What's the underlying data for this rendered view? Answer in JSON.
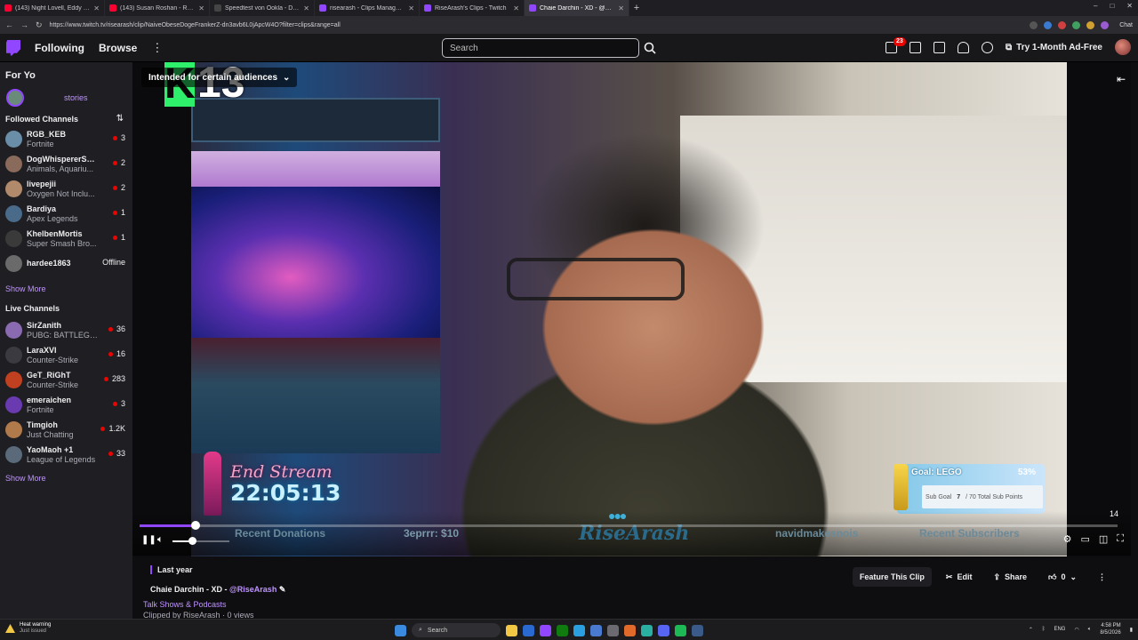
{
  "browser": {
    "tabs": [
      {
        "title": "(143) Night Lovell, Eddy Baker, BO",
        "favicon_color": "#ff0033",
        "active": false
      },
      {
        "title": "(143) Susan Roshan - Roohe Sheyd",
        "favicon_color": "#ff0033",
        "active": false
      },
      {
        "title": "Speedtest von Ookla - Der umfass",
        "favicon_color": "#444444",
        "active": false
      },
      {
        "title": "risearash - Clips Manager - Twitch",
        "favicon_color": "#9147ff",
        "active": false
      },
      {
        "title": "RiseArash's Clips - Twitch",
        "favicon_color": "#9147ff",
        "active": false
      },
      {
        "title": "Chaie Darchin - XD - @RiseArash",
        "favicon_color": "#9147ff",
        "active": true
      }
    ],
    "url": "https://www.twitch.tv/risearash/clip/NaiveObeseDogeFrankerZ-dn3avb6L0jApcW4O?filter=clips&range=all",
    "chat_label": "Chat"
  },
  "topnav": {
    "following": "Following",
    "browse": "Browse",
    "search_placeholder": "Search",
    "notifications_count": "23",
    "ad_free": "Try 1-Month Ad-Free"
  },
  "sidebar": {
    "for_you_label": "For Yo",
    "stories_label": "stories",
    "followed_header": "Followed Channels",
    "followed": [
      {
        "name": "RGB_KEB",
        "game": "Fortnite",
        "viewers": "3",
        "live": true,
        "avatar_color": "#6a8ea8"
      },
      {
        "name": "DogWhispererSh...",
        "game": "Animals, Aquariu...",
        "viewers": "2",
        "live": true,
        "avatar_color": "#8a6a5a"
      },
      {
        "name": "livepejii",
        "game": "Oxygen Not Inclu...",
        "viewers": "2",
        "live": true,
        "avatar_color": "#b08a6a"
      },
      {
        "name": "Bardiya",
        "game": "Apex Legends",
        "viewers": "1",
        "live": true,
        "avatar_color": "#4a6a8a"
      },
      {
        "name": "KhelbenMortis",
        "game": "Super Smash Bro...",
        "viewers": "1",
        "live": true,
        "avatar_color": "#3a3a3a"
      },
      {
        "name": "hardee1863",
        "game": "",
        "viewers": "Offline",
        "live": false,
        "avatar_color": "#6a6a6a"
      }
    ],
    "show_more": "Show More",
    "live_header": "Live Channels",
    "live": [
      {
        "name": "SirZanith",
        "game": "PUBG: BATTLEGR...",
        "viewers": "36",
        "avatar_color": "#8a6ab0"
      },
      {
        "name": "LaraXVI",
        "game": "Counter-Strike",
        "viewers": "16",
        "avatar_color": "#3a3a40"
      },
      {
        "name": "GeT_RiGhT",
        "game": "Counter-Strike",
        "viewers": "283",
        "avatar_color": "#c04020"
      },
      {
        "name": "emeraichen",
        "game": "Fortnite",
        "viewers": "3",
        "avatar_color": "#6a3ab0"
      },
      {
        "name": "Timgioh",
        "game": "Just Chatting",
        "viewers": "1.2K",
        "avatar_color": "#b07a4a"
      },
      {
        "name": "YaoMaoh +1",
        "game": "League of Legends",
        "viewers": "33",
        "avatar_color": "#5a6a7a"
      }
    ],
    "show_more_2": "Show More"
  },
  "video": {
    "k_badge": "K",
    "rating_number": "13",
    "audience_label": "Intended for certain audiences",
    "end_stream_label": "End Stream",
    "end_stream_time": "22:05:13",
    "goal_label": "Goal:  LEGO",
    "goal_percent": "53%",
    "goal_sub_label": "Sub Goal",
    "goal_sub_count": "7",
    "goal_sub_total": "/ 70 Total Sub Points",
    "overlay_recent_donations": "Recent Donations",
    "overlay_donation": "3eprrr: $10",
    "overlay_logo": "RiseArash",
    "overlay_follower": "navidmakesnois",
    "overlay_recent_subs": "Recent Subscribers",
    "timestamp": "14",
    "progress_fraction": 0.057,
    "volume_fraction": 0.35
  },
  "clip": {
    "posted": "Last year",
    "title": "Chaie Darchin - XD - ",
    "mention": "@RiseArash",
    "category": "Talk Shows & Podcasts",
    "clipped_by": "Clipped by RiseArash · 0 views",
    "feature_btn": "Feature This Clip",
    "edit_btn": "Edit",
    "share_btn": "Share",
    "like_count": "0"
  },
  "taskbar": {
    "warning_title": "Heat warning",
    "warning_sub": "Just issued",
    "search_label": "Search",
    "lang": "ENG",
    "time": "4:58 PM",
    "date": "8/5/2026"
  },
  "colors": {
    "accent": "#9147ff",
    "live_red": "#eb0400",
    "link": "#bf94ff"
  }
}
